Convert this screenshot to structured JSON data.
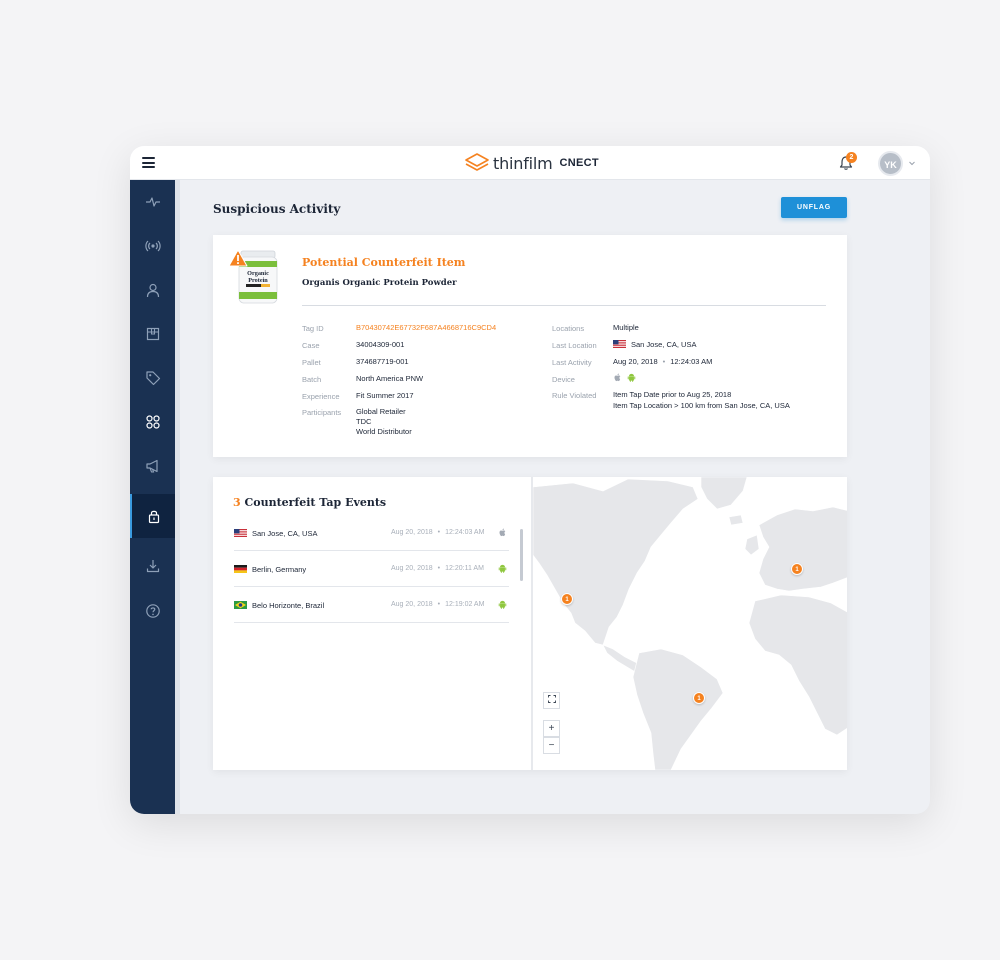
{
  "header": {
    "brand": "thinfilm",
    "product": "CNECT",
    "notification_count": "2",
    "avatar_initials": "YK"
  },
  "sidebar": {
    "items": [
      {
        "icon": "activity-icon"
      },
      {
        "icon": "broadcast-icon"
      },
      {
        "icon": "user-icon"
      },
      {
        "icon": "box-icon"
      },
      {
        "icon": "tag-icon"
      },
      {
        "icon": "grid-icon"
      },
      {
        "icon": "megaphone-icon"
      },
      {
        "icon": "lock-icon",
        "active": true
      },
      {
        "icon": "download-icon"
      },
      {
        "icon": "help-icon"
      }
    ]
  },
  "page": {
    "title": "Suspicious Activity",
    "unflag_label": "UNFLAG"
  },
  "detail": {
    "alert_title": "Potential Counterfeit Item",
    "product_name": "Organis Organic Protein Powder",
    "product_image_text": "Organic Protein",
    "left_fields": [
      {
        "label": "Tag ID",
        "value": "B70430742E67732F687A4668716C9CD4"
      },
      {
        "label": "Case",
        "value": "34004309-001"
      },
      {
        "label": "Pallet",
        "value": "374687719-001"
      },
      {
        "label": "Batch",
        "value": "North America PNW"
      },
      {
        "label": "Experience",
        "value": "Fit Summer 2017"
      },
      {
        "label": "Participants",
        "values": [
          "Global Retailer",
          "TDC",
          "World Distributor"
        ]
      }
    ],
    "right_fields": [
      {
        "label": "Locations",
        "value": "Multiple"
      },
      {
        "label": "Last Location",
        "value": "San Jose, CA, USA",
        "flag": "us"
      },
      {
        "label": "Last Activity",
        "date": "Aug 20, 2018",
        "time": "12:24:03 AM"
      },
      {
        "label": "Device",
        "devices": [
          "apple",
          "android"
        ]
      },
      {
        "label": "Rule Violated",
        "values": [
          "Item Tap Date prior to Aug 25, 2018",
          "Item Tap Location > 100 km from San Jose, CA, USA"
        ]
      }
    ]
  },
  "events": {
    "count": "3",
    "title": "Counterfeit Tap Events",
    "rows": [
      {
        "location": "San Jose, CA, USA",
        "flag": "us",
        "date": "Aug 20, 2018",
        "time": "12:24:03 AM",
        "device": "apple"
      },
      {
        "location": "Berlin, Germany",
        "flag": "de",
        "date": "Aug 20, 2018",
        "time": "12:20:11 AM",
        "device": "android"
      },
      {
        "location": "Belo Horizonte, Brazil",
        "flag": "br",
        "date": "Aug 20, 2018",
        "time": "12:19:02 AM",
        "device": "android"
      }
    ]
  },
  "map": {
    "markers": [
      {
        "label": "1",
        "place": "San Jose"
      },
      {
        "label": "1",
        "place": "Berlin"
      },
      {
        "label": "1",
        "place": "Belo Horizonte"
      }
    ],
    "fullscreen_icon": "expand-icon",
    "zoom_in_label": "+",
    "zoom_out_label": "−"
  },
  "colors": {
    "accent": "#f58220",
    "primary_button": "#1e90d8",
    "sidebar": "#1a3152",
    "map_land": "#e6e7ea"
  }
}
